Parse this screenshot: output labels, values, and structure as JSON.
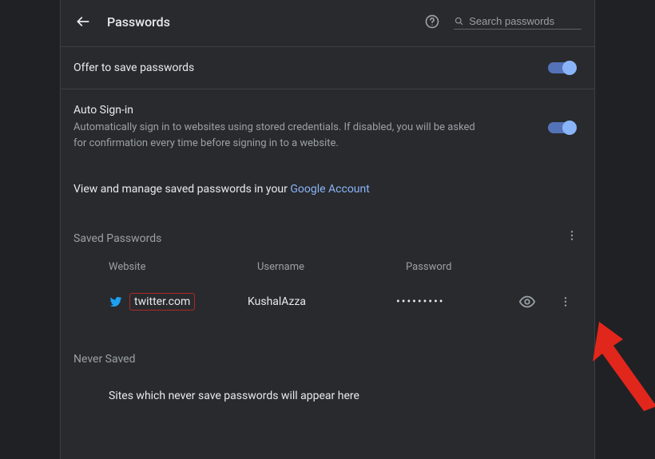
{
  "header": {
    "title": "Passwords",
    "search_placeholder": "Search passwords"
  },
  "offer": {
    "label": "Offer to save passwords",
    "on": true
  },
  "autosignin": {
    "label": "Auto Sign-in",
    "desc": "Automatically sign in to websites using stored credentials. If disabled, you will be asked for confirmation every time before signing in to a website.",
    "on": true
  },
  "view_manage": {
    "prefix": "View and manage saved passwords in your ",
    "link": "Google Account"
  },
  "saved": {
    "label": "Saved Passwords",
    "columns": {
      "website": "Website",
      "username": "Username",
      "password": "Password"
    },
    "entries": [
      {
        "site": "twitter.com",
        "username": "KushalAzza",
        "password_mask": "•••••••••"
      }
    ]
  },
  "never": {
    "label": "Never Saved",
    "empty": "Sites which never save passwords will appear here"
  }
}
